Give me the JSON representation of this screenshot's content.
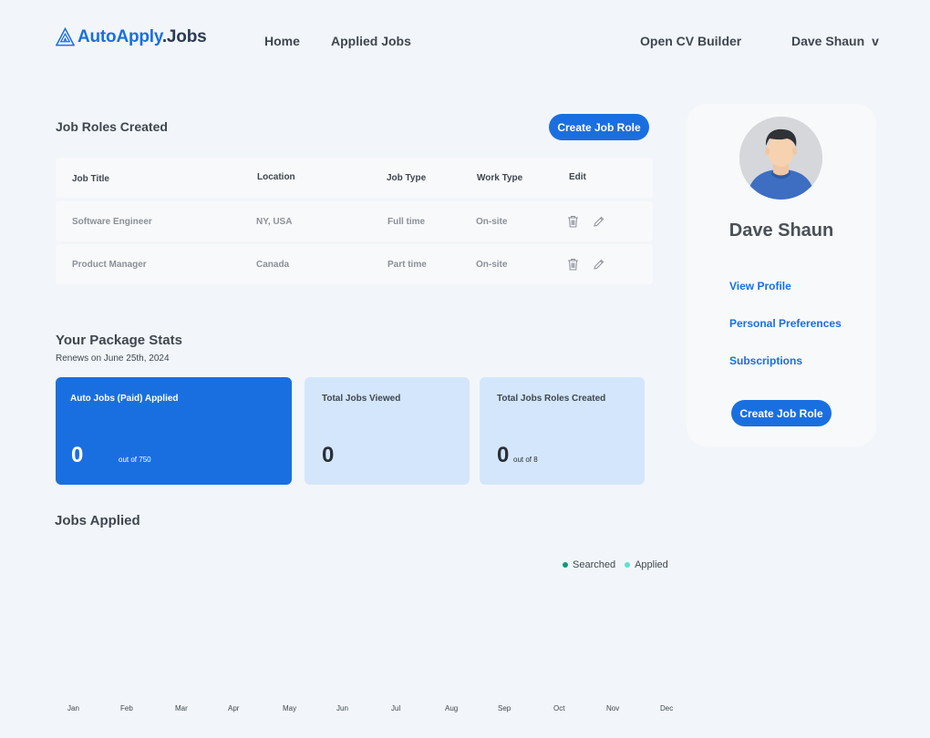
{
  "app": {
    "logo_part1": "AutoApply",
    "logo_part2": ".Jobs",
    "brand_color": "#1a6fe0"
  },
  "nav": {
    "home": "Home",
    "applied_jobs": "Applied Jobs",
    "cv_builder": "Open CV Builder",
    "user_name": "Dave Shaun",
    "user_chevron": "v"
  },
  "job_roles": {
    "title": "Job Roles Created",
    "create_button": "Create Job Role",
    "columns": [
      "Job Title",
      "Location",
      "Job Type",
      "Work Type",
      "Edit"
    ],
    "rows": [
      {
        "title": "Software Engineer",
        "location": "NY, USA",
        "job_type": "Full time",
        "work_type": "On-site",
        "icons": [
          "trash-icon",
          "pencil-icon"
        ]
      },
      {
        "title": "Product Manager",
        "location": "Canada",
        "job_type": "Part time",
        "work_type": "On-site",
        "icons": [
          "trash-icon",
          "pencil-icon"
        ]
      }
    ]
  },
  "package_stats": {
    "title": "Your Package Stats",
    "renews": "Renews on June 25th, 2024",
    "cards": [
      {
        "label": "Auto Jobs (Paid) Applied",
        "value": "0",
        "sub": "out of 750"
      },
      {
        "label": "Total Jobs Viewed",
        "value": "0",
        "sub": ""
      },
      {
        "label": "Total Jobs Roles Created",
        "value": "0",
        "sub": "out of 8"
      }
    ]
  },
  "profile": {
    "name": "Dave Shaun",
    "links": [
      "View Profile",
      "Personal Preferences",
      "Subscriptions"
    ],
    "create_button": "Create Job Role"
  },
  "jobs_applied": {
    "title": "Jobs Applied",
    "legend": [
      {
        "name": "Searched",
        "color": "#0f9a7a"
      },
      {
        "name": "Applied",
        "color": "#5ee0d0"
      }
    ],
    "months": [
      "Jan",
      "Feb",
      "Mar",
      "Apr",
      "May",
      "Jun",
      "Jul",
      "Aug",
      "Sep",
      "Oct",
      "Nov",
      "Dec"
    ]
  }
}
